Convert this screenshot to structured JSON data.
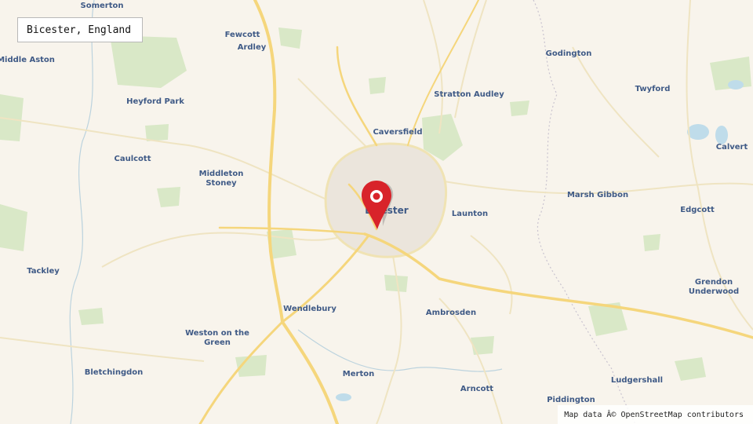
{
  "search": {
    "value": "Bicester, England"
  },
  "attribution": "Map data Â© OpenStreetMap contributors",
  "colors": {
    "background": "#f8f4ec",
    "major_road": "#f5d67c",
    "minor_road": "#f0e3b4",
    "urban": "#ece6dc",
    "woodland": "#d9e8c7",
    "water": "#bfdcea",
    "label": "#3f5a86",
    "pin": "#d8232a"
  },
  "places": [
    {
      "id": "somerton",
      "name": "Somerton"
    },
    {
      "id": "fewcott",
      "name": "Fewcott"
    },
    {
      "id": "ardley",
      "name": "Ardley"
    },
    {
      "id": "middle-aston",
      "name": "Middle Aston"
    },
    {
      "id": "godington",
      "name": "Godington"
    },
    {
      "id": "heyford-park",
      "name": "Heyford Park"
    },
    {
      "id": "stratton-audley",
      "name": "Stratton Audley"
    },
    {
      "id": "twyford",
      "name": "Twyford"
    },
    {
      "id": "caversfield",
      "name": "Caversfield"
    },
    {
      "id": "calvert",
      "name": "Calvert"
    },
    {
      "id": "caulcott",
      "name": "Caulcott"
    },
    {
      "id": "middleton-stoney",
      "name": "Middleton Stoney"
    },
    {
      "id": "marsh-gibbon",
      "name": "Marsh Gibbon"
    },
    {
      "id": "bicester",
      "name": "Bicester"
    },
    {
      "id": "launton",
      "name": "Launton"
    },
    {
      "id": "edgcott",
      "name": "Edgcott"
    },
    {
      "id": "tackley",
      "name": "Tackley"
    },
    {
      "id": "grendon-underwood",
      "name": "Grendon Underwood"
    },
    {
      "id": "wendlebury",
      "name": "Wendlebury"
    },
    {
      "id": "ambrosden",
      "name": "Ambrosden"
    },
    {
      "id": "weston-on-the-green",
      "name": "Weston on the Green"
    },
    {
      "id": "bletchingdon",
      "name": "Bletchingdon"
    },
    {
      "id": "merton",
      "name": "Merton"
    },
    {
      "id": "ludgershall",
      "name": "Ludgershall"
    },
    {
      "id": "arncott",
      "name": "Arncott"
    },
    {
      "id": "piddington",
      "name": "Piddington"
    }
  ]
}
